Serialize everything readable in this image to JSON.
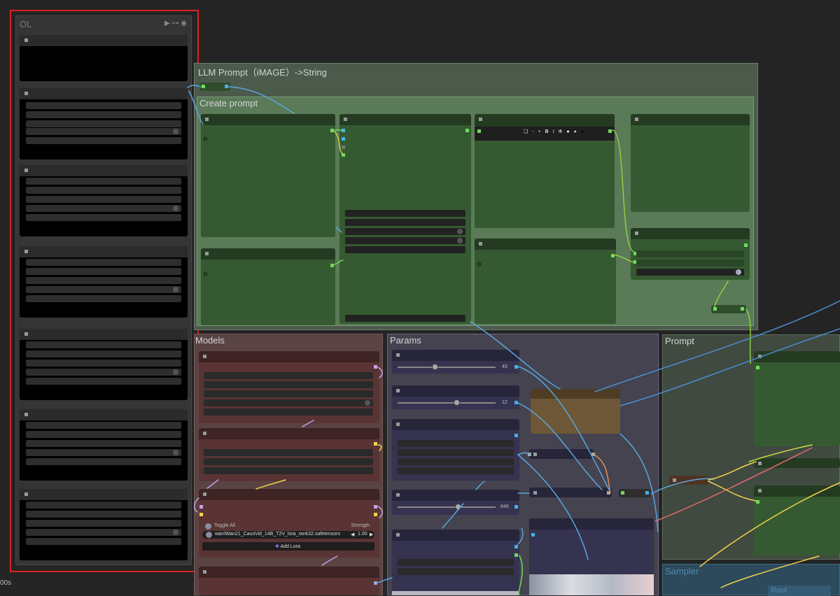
{
  "ol_group": {
    "title": "OL",
    "icons": [
      "play-icon",
      "link-icon",
      "eye-icon"
    ]
  },
  "llm_group": {
    "title": "LLM Prompt（iMAGE）->String"
  },
  "create_group": {
    "title": "Create prompt"
  },
  "models_group": {
    "title": "Models"
  },
  "params_group": {
    "title": "Params"
  },
  "prompt_group": {
    "title": "Prompt"
  },
  "sampler_group": {
    "title": "Sampler"
  },
  "rout_label": "Rout",
  "params": {
    "slider1": "49",
    "slider2": "12",
    "slider3": "848"
  },
  "lora": {
    "toggle_label": "Toggle All",
    "strength_label": "Strength",
    "file": "wan\\Wan21_CausVid_14B_T2V_lora_rank32.safetensors",
    "strength_value": "1.00",
    "add_label": "Add Lora"
  },
  "toolbar_icons": [
    "square-icon",
    "minus-icon",
    "plus-icon",
    "bold-icon",
    "italic-icon",
    "gear-icon",
    "circle-white-icon",
    "circle-gray-icon",
    "circle-black-icon"
  ],
  "timer": "00s",
  "colors": {
    "selection": "#e02020",
    "green_node": "#355a32",
    "red_node": "#5a3434",
    "purple_node": "#35334f"
  }
}
